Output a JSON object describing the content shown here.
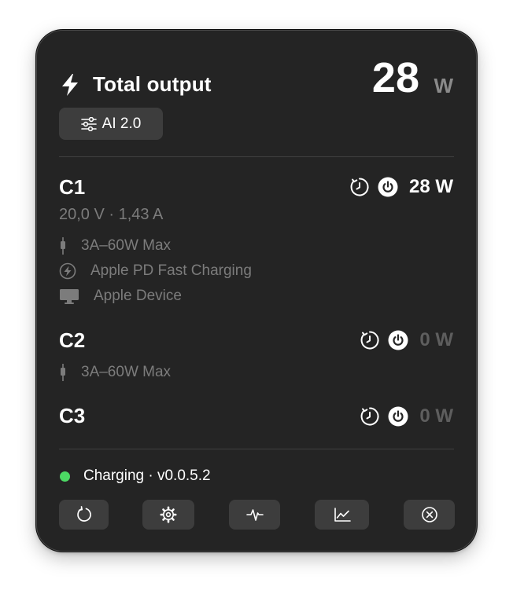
{
  "header": {
    "title": "Total output",
    "total_value": "28",
    "total_unit": "W",
    "mode_label": "AI 2.0"
  },
  "ports": [
    {
      "name": "C1",
      "watt": "28 W",
      "active": true,
      "voltage_current": "20,0 V · 1,43 A",
      "cable": "3A–60W Max",
      "protocol": "Apple PD Fast Charging",
      "device": "Apple Device"
    },
    {
      "name": "C2",
      "watt": "0 W",
      "active": false,
      "cable": "3A–60W Max"
    },
    {
      "name": "C3",
      "watt": "0 W",
      "active": false
    }
  ],
  "status": {
    "text": "Charging · v0.0.5.2",
    "dot_color": "#4cd964"
  },
  "toolbar": [
    "refresh-icon",
    "gear-icon",
    "pulse-icon",
    "line-chart-icon",
    "close-circle-icon"
  ],
  "colors": {
    "panel": "#242424",
    "button": "#3d3d3d",
    "muted_text": "#7c7c7c",
    "inactive_watt": "#5e5e5e"
  }
}
